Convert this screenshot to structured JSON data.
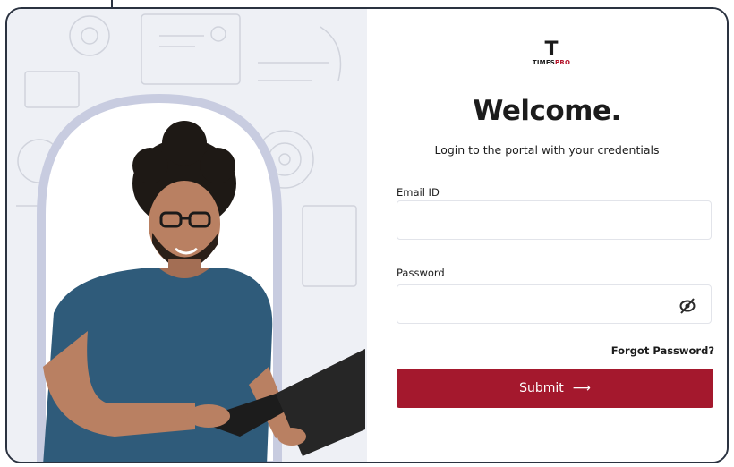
{
  "brand": {
    "mark": "T",
    "name_part1": "TIMES",
    "name_part2": "PRO",
    "accent_color": "#a4182d"
  },
  "login": {
    "title": "Welcome.",
    "subtitle": "Login to the portal with your credentials",
    "email_label": "Email ID",
    "email_value": "",
    "password_label": "Password",
    "password_value": "",
    "password_toggle_icon": "eye-off-icon",
    "forgot_label": "Forgot Password?",
    "submit_label": "Submit",
    "submit_icon": "arrow-right-icon"
  }
}
